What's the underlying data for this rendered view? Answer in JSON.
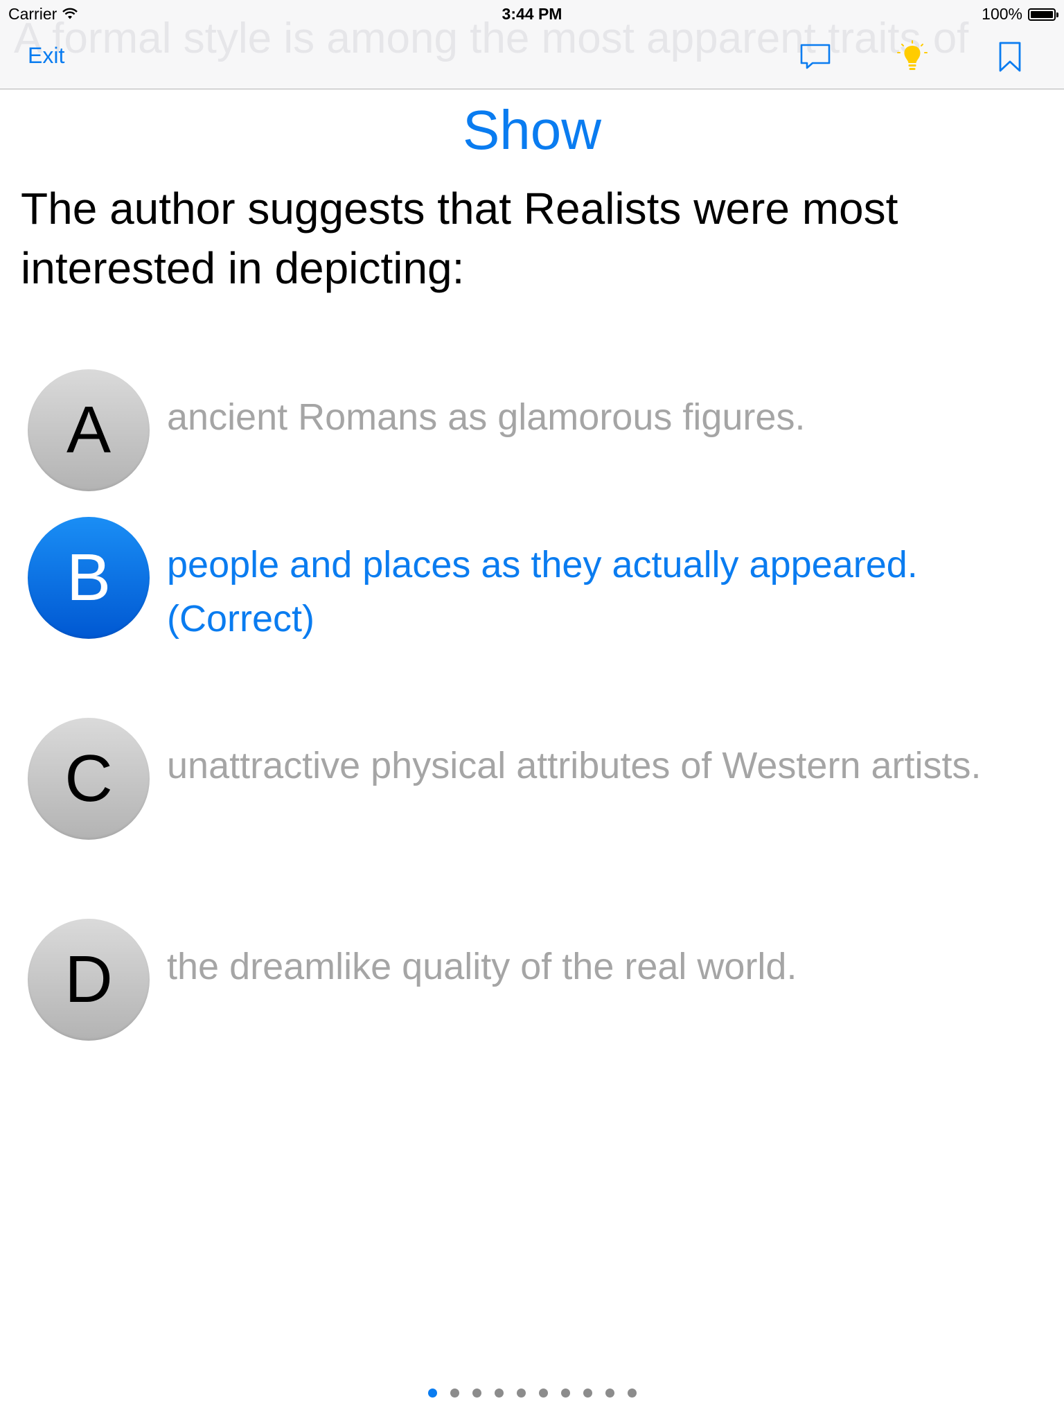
{
  "status_bar": {
    "carrier": "Carrier",
    "time": "3:44 PM",
    "battery": "100%"
  },
  "nav": {
    "exit_label": "Exit",
    "background_text": "A formal style is among the most apparent traits of",
    "icons": [
      "comment-icon",
      "lightbulb-icon",
      "bookmark-icon"
    ]
  },
  "show_label": "Show",
  "question": "The author suggests that Realists were most interested in depicting:",
  "options": [
    {
      "letter": "A",
      "text": "ancient Romans as glamorous figures.",
      "selected": false
    },
    {
      "letter": "B",
      "text": "people and places as they actually appeared. (Correct)",
      "selected": true
    },
    {
      "letter": "C",
      "text": "unattractive physical attributes of Western artists.",
      "selected": false
    },
    {
      "letter": "D",
      "text": "the dreamlike quality of the real world.",
      "selected": false
    }
  ],
  "pagination": {
    "current": 1,
    "total": 10
  },
  "colors": {
    "accent": "#0a7cf0",
    "selected_circle": "#0a7cf0",
    "unselected_circle": "#c4c4c4",
    "muted_text": "#a5a5a5",
    "lightbulb": "#ffcc00"
  }
}
